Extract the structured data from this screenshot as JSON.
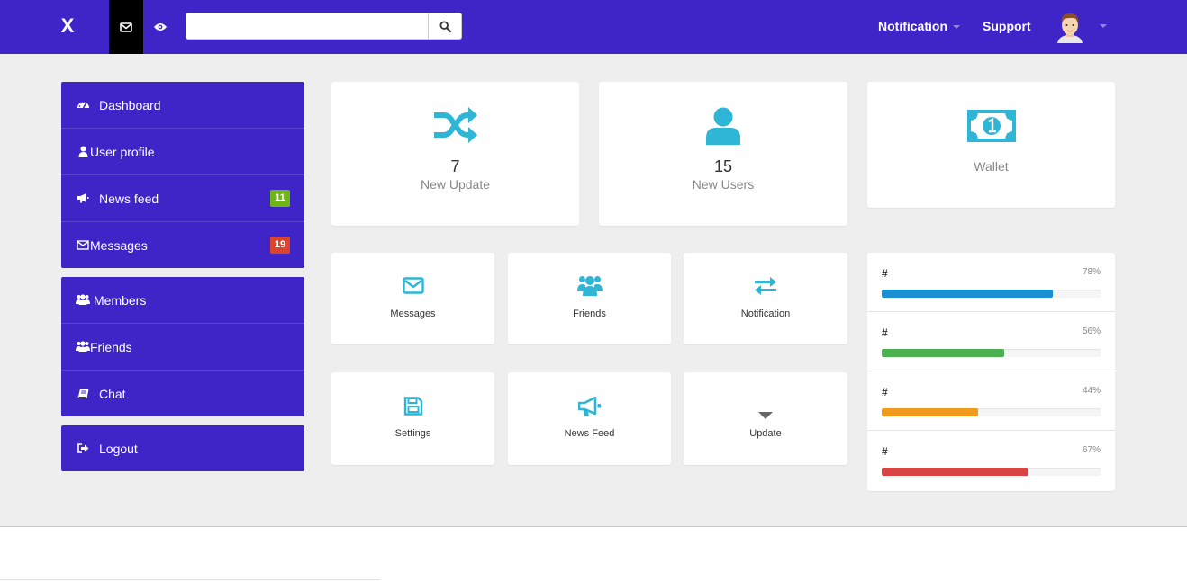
{
  "header": {
    "brand": "X",
    "search_placeholder": "",
    "notification_label": "Notification",
    "support_label": "Support"
  },
  "sidebar": {
    "groups": [
      {
        "items": [
          {
            "label": "Dashboard",
            "icon": "dashboard-icon"
          },
          {
            "label": "User profile",
            "icon": "user-icon"
          },
          {
            "label": "News feed",
            "icon": "bullhorn-icon",
            "badge": "11",
            "badge_color": "#6fb515"
          },
          {
            "label": "Messages",
            "icon": "envelope-icon",
            "badge": "19",
            "badge_color": "#d9442c"
          }
        ]
      },
      {
        "items": [
          {
            "label": "Members",
            "icon": "users-icon"
          },
          {
            "label": "Friends",
            "icon": "users-icon"
          },
          {
            "label": "Chat",
            "icon": "book-icon"
          }
        ]
      },
      {
        "items": [
          {
            "label": "Logout",
            "icon": "sign-out-icon"
          }
        ]
      }
    ]
  },
  "stats": [
    {
      "value": "7",
      "label": "New Update",
      "icon": "random-icon"
    },
    {
      "value": "15",
      "label": "New Users",
      "icon": "user-icon"
    },
    {
      "value": "",
      "label": "Wallet",
      "icon": "money-icon"
    }
  ],
  "tiles": [
    {
      "label": "Messages",
      "icon": "envelope-icon"
    },
    {
      "label": "Friends",
      "icon": "users-icon"
    },
    {
      "label": "Notification",
      "icon": "exchange-icon"
    },
    {
      "label": "Settings",
      "icon": "save-icon"
    },
    {
      "label": "News Feed",
      "icon": "bullhorn-icon"
    },
    {
      "label": "Update",
      "icon": "caret-down-icon"
    }
  ],
  "progress": [
    {
      "label": "#",
      "percent_label": "78%",
      "value": 78,
      "color": "#1a8fd2"
    },
    {
      "label": "#",
      "percent_label": "56%",
      "value": 56,
      "color": "#4cb050"
    },
    {
      "label": "#",
      "percent_label": "44%",
      "value": 44,
      "color": "#f19b1e"
    },
    {
      "label": "#",
      "percent_label": "67%",
      "value": 67,
      "color": "#d94545"
    }
  ],
  "colors": {
    "primary": "#3f24c7",
    "accent_icon": "#2fb5d5",
    "background": "#eeeeee"
  }
}
